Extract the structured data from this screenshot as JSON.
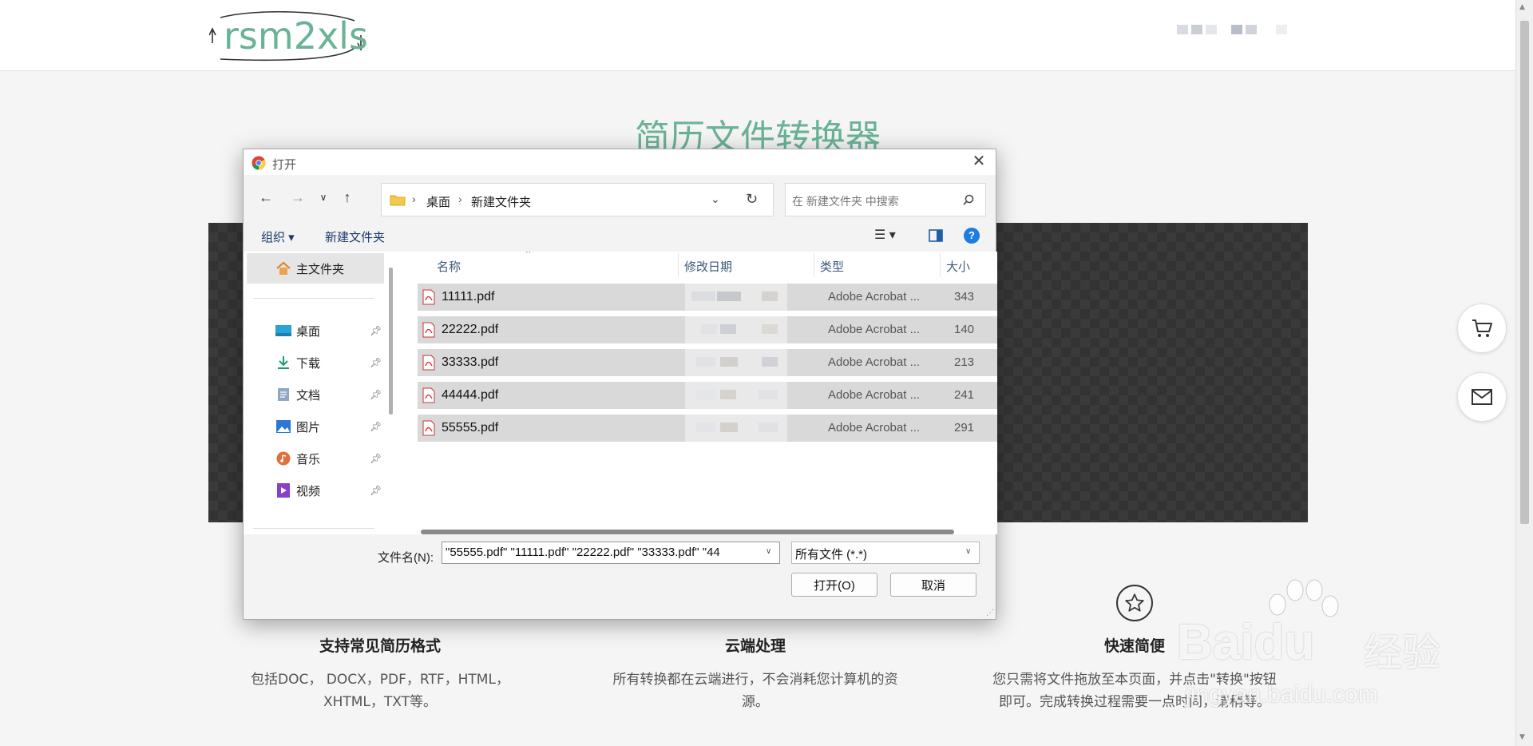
{
  "site": {
    "logo_text": "rsm2xls",
    "page_title": "简历文件转换器",
    "features": [
      {
        "title": "支持常见简历格式",
        "text": "包括DOC， DOCX，PDF，RTF，HTML，XHTML，TXT等。"
      },
      {
        "title": "云端处理",
        "text": "所有转换都在云端进行，不会消耗您计算机的资源。"
      },
      {
        "title": "快速简便",
        "text": "您只需将文件拖放至本页面，并点击\"转换\"按钮即可。完成转换过程需要一点时间，请稍等。"
      }
    ],
    "side_buttons": [
      "cart-icon",
      "mail-icon"
    ],
    "accent_color": "#6ab396"
  },
  "dialog": {
    "title": "打开",
    "breadcrumb": [
      "桌面",
      "新建文件夹"
    ],
    "search_placeholder": "在 新建文件夹 中搜索",
    "toolbar": {
      "organize": "组织 ▾",
      "new_folder": "新建文件夹"
    },
    "sidebar": {
      "home": "主文件夹",
      "items": [
        {
          "label": "桌面",
          "icon": "desktop-icon"
        },
        {
          "label": "下载",
          "icon": "download-icon"
        },
        {
          "label": "文档",
          "icon": "document-icon"
        },
        {
          "label": "图片",
          "icon": "pictures-icon"
        },
        {
          "label": "音乐",
          "icon": "music-icon"
        },
        {
          "label": "视频",
          "icon": "video-icon"
        }
      ]
    },
    "columns": {
      "name": "名称",
      "date": "修改日期",
      "type": "类型",
      "size": "大小"
    },
    "files": [
      {
        "name": "11111.pdf",
        "type": "Adobe Acrobat ...",
        "size": "343"
      },
      {
        "name": "22222.pdf",
        "type": "Adobe Acrobat ...",
        "size": "140"
      },
      {
        "name": "33333.pdf",
        "type": "Adobe Acrobat ...",
        "size": "213"
      },
      {
        "name": "44444.pdf",
        "type": "Adobe Acrobat ...",
        "size": "241"
      },
      {
        "name": "55555.pdf",
        "type": "Adobe Acrobat ...",
        "size": "291"
      }
    ],
    "filename_label": "文件名(N):",
    "filename_value": "\"55555.pdf\" \"11111.pdf\" \"22222.pdf\" \"33333.pdf\" \"44",
    "filetype_value": "所有文件 (*.*)",
    "open_button": "打开(O)",
    "cancel_button": "取消"
  },
  "watermark": {
    "brand": "Baidu",
    "brand_cn": "经验",
    "url": "jingyan.baidu.com"
  }
}
